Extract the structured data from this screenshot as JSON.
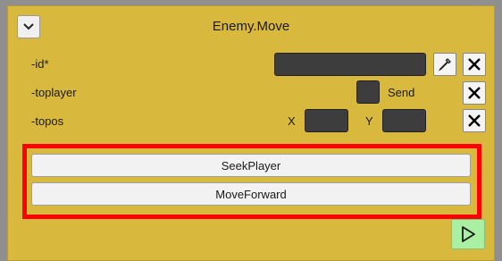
{
  "header": {
    "title": "Enemy.Move"
  },
  "fields": {
    "id_label": "-id*",
    "toplayer_label": "-toplayer",
    "toplayer_send_label": "Send",
    "topos_label": "-topos",
    "topos_x_label": "X",
    "topos_y_label": "Y"
  },
  "actions": {
    "items": [
      {
        "label": "SeekPlayer"
      },
      {
        "label": "MoveForward"
      }
    ]
  },
  "icons": {
    "collapse": "chevron-down-icon",
    "picker": "eyedropper-icon",
    "remove": "close-icon",
    "run": "play-icon"
  },
  "colors": {
    "panel_bg": "#d9b83e",
    "highlight": "#ff0000",
    "field_bg": "#3d3d3d",
    "play_bg": "#a9f0a2"
  }
}
